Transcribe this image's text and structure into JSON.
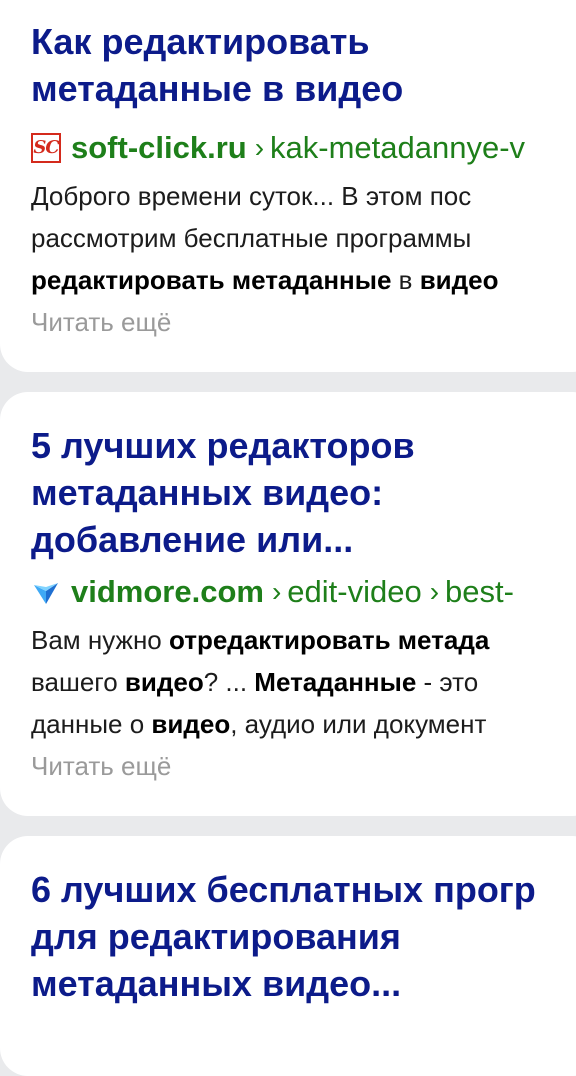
{
  "results": [
    {
      "title_lines": [
        "Как редактировать",
        "метаданные в видео"
      ],
      "favicon_icon": "soft-click-logo-icon",
      "favicon_text": "SC",
      "domain": "soft-click.ru",
      "separator": "›",
      "path": "kak-metadannye-v",
      "snippet_lines": [
        [
          {
            "t": "Доброго времени суток... В этом пос",
            "b": false
          }
        ],
        [
          {
            "t": "рассмотрим бесплатные программы",
            "b": false
          }
        ],
        [
          {
            "t": "редактировать метаданные",
            "b": true
          },
          {
            "t": " в ",
            "b": false
          },
          {
            "t": "видео",
            "b": true
          }
        ]
      ],
      "read_more": "Читать ещё"
    },
    {
      "title_lines": [
        "5 лучших редакторов",
        "метаданных видео:",
        "добавление или..."
      ],
      "favicon_icon": "vidmore-logo-icon",
      "domain": "vidmore.com",
      "separator": "›",
      "path": "edit-video",
      "separator2": "›",
      "path2": "best-",
      "snippet_lines": [
        [
          {
            "t": "Вам нужно ",
            "b": false
          },
          {
            "t": "отредактировать метада",
            "b": true
          }
        ],
        [
          {
            "t": "вашего ",
            "b": false
          },
          {
            "t": "видео",
            "b": true
          },
          {
            "t": "? ... ",
            "b": false
          },
          {
            "t": "Метаданные",
            "b": true
          },
          {
            "t": " - это ",
            "b": false
          }
        ],
        [
          {
            "t": "данные о ",
            "b": false
          },
          {
            "t": "видео",
            "b": true
          },
          {
            "t": ", аудио или документ",
            "b": false
          }
        ]
      ],
      "read_more": "Читать ещё"
    },
    {
      "title_lines": [
        "6 лучших бесплатных прогр",
        "для редактирования",
        "метаданных видео..."
      ]
    }
  ],
  "colors": {
    "title": "#0c1b8a",
    "url": "#1e7f1a",
    "read_more": "#9a9a9a",
    "background": "#e9eaec",
    "card": "#ffffff"
  }
}
